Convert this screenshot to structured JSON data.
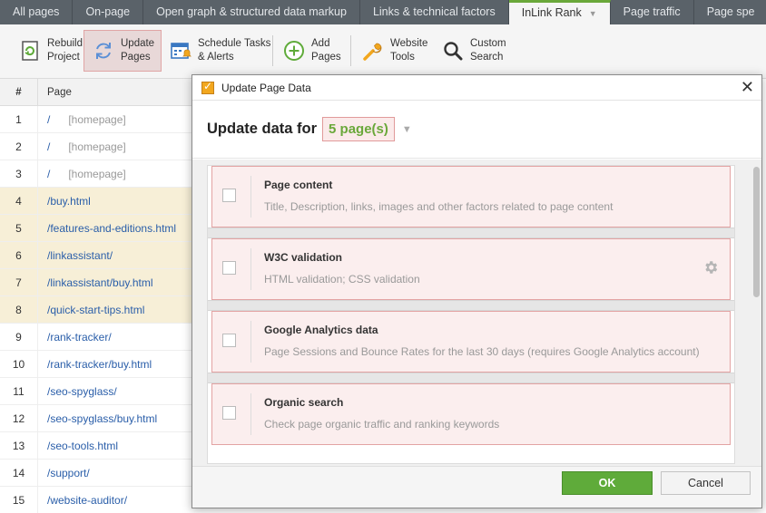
{
  "tabs": [
    {
      "label": "All pages"
    },
    {
      "label": "On-page"
    },
    {
      "label": "Open graph & structured data markup"
    },
    {
      "label": "Links & technical factors"
    },
    {
      "label": "InLink Rank",
      "active": true
    },
    {
      "label": "Page traffic"
    },
    {
      "label": "Page spe"
    }
  ],
  "toolbar": {
    "rebuild": {
      "line1": "Rebuild",
      "line2": "Project"
    },
    "update": {
      "line1": "Update",
      "line2": "Pages"
    },
    "schedule": {
      "line1": "Schedule Tasks",
      "line2": "& Alerts"
    },
    "add": {
      "line1": "Add",
      "line2": "Pages"
    },
    "website": {
      "line1": "Website",
      "line2": "Tools"
    },
    "custom": {
      "line1": "Custom",
      "line2": "Search"
    }
  },
  "table": {
    "col_num": "#",
    "col_page": "Page",
    "rows": [
      {
        "n": "1",
        "page": "/",
        "hp": "[homepage]"
      },
      {
        "n": "2",
        "page": "/",
        "hp": "[homepage]"
      },
      {
        "n": "3",
        "page": "/",
        "hp": "[homepage]"
      },
      {
        "n": "4",
        "page": "/buy.html",
        "hp": ""
      },
      {
        "n": "5",
        "page": "/features-and-editions.html",
        "hp": ""
      },
      {
        "n": "6",
        "page": "/linkassistant/",
        "hp": ""
      },
      {
        "n": "7",
        "page": "/linkassistant/buy.html",
        "hp": ""
      },
      {
        "n": "8",
        "page": "/quick-start-tips.html",
        "hp": ""
      },
      {
        "n": "9",
        "page": "/rank-tracker/",
        "hp": ""
      },
      {
        "n": "10",
        "page": "/rank-tracker/buy.html",
        "hp": ""
      },
      {
        "n": "11",
        "page": "/seo-spyglass/",
        "hp": ""
      },
      {
        "n": "12",
        "page": "/seo-spyglass/buy.html",
        "hp": ""
      },
      {
        "n": "13",
        "page": "/seo-tools.html",
        "hp": ""
      },
      {
        "n": "14",
        "page": "/support/",
        "hp": ""
      },
      {
        "n": "15",
        "page": "/website-auditor/",
        "hp": ""
      }
    ]
  },
  "dialog": {
    "title": "Update Page Data",
    "heading": "Update data for",
    "count": "5 page(s)",
    "items": [
      {
        "name": "Page content",
        "desc": "Title, Description, links, images and other factors related to page content"
      },
      {
        "name": "W3C validation",
        "desc": "HTML validation; CSS validation"
      },
      {
        "name": "Google Analytics data",
        "desc": "Page Sessions and Bounce Rates for the last 30 days (requires Google Analytics account)"
      },
      {
        "name": "Organic search",
        "desc": "Check page organic traffic and ranking keywords"
      }
    ],
    "ok_label": "OK",
    "cancel_label": "Cancel"
  },
  "colors": {
    "accent_green": "#6aa83a",
    "link_blue": "#2a5ea9",
    "highlight_red": "#e19a9a",
    "selected_row": "#f7efd7"
  }
}
